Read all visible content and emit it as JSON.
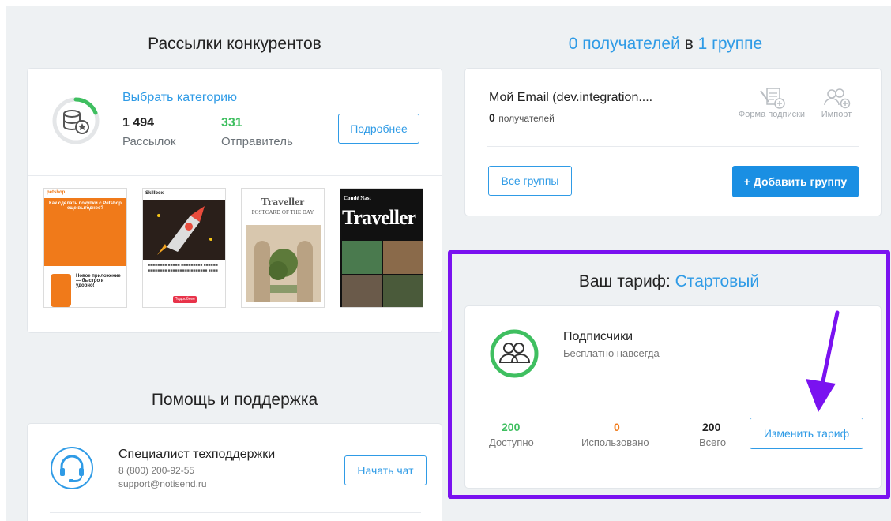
{
  "competitors": {
    "title": "Рассылки конкурентов",
    "choose_category": "Выбрать категорию",
    "mailings_count": "1 494",
    "mailings_label": "Рассылок",
    "senders_count": "331",
    "senders_label": "Отправитель",
    "details_button": "Подробнее",
    "thumbnails": [
      {
        "brand": "petshop",
        "headline": "Как сделать покупки с Petshop еще выгоднее?",
        "footer": "Новое приложение — быстро и удобно!"
      },
      {
        "brand": "Skillbox",
        "button": "Подробнее"
      },
      {
        "brand": "Traveller",
        "headline": "POSTCARD OF THE DAY"
      },
      {
        "brand": "Condé Nast",
        "headline": "Traveller"
      }
    ]
  },
  "recipients": {
    "count": "0 получателей",
    "in_word": "в",
    "groups": "1 группе"
  },
  "group_card": {
    "name": "Мой Email (dev.integration....",
    "recipients_count": "0",
    "recipients_label": "получателей",
    "subscribe_form": "Форма подписки",
    "import": "Импорт",
    "all_groups_button": "Все группы",
    "add_group_button": "+ Добавить группу"
  },
  "tariff": {
    "title_prefix": "Ваш тариф:",
    "plan_name": "Стартовый",
    "subscribers_title": "Подписчики",
    "subscribers_sub": "Бесплатно навсегда",
    "available_value": "200",
    "available_label": "Доступно",
    "used_value": "0",
    "used_label": "Использовано",
    "total_value": "200",
    "total_label": "Всего",
    "change_button": "Изменить тариф"
  },
  "support": {
    "title": "Помощь и поддержка",
    "specialist": "Специалист техподдержки",
    "phone": "8 (800) 200-92-55",
    "email": "support@notisend.ru",
    "chat_button": "Начать чат"
  },
  "colors": {
    "accent": "#2f9be6",
    "green": "#3fbf60",
    "orange": "#f07a1a",
    "purple_highlight": "#7a12f0"
  }
}
